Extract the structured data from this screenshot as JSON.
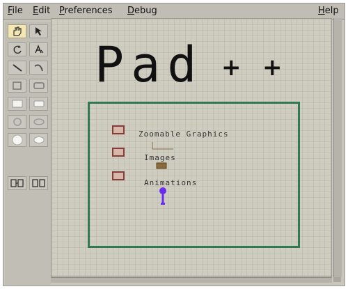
{
  "menubar": {
    "items": [
      "File",
      "Edit",
      "Preferences",
      "Debug"
    ],
    "help": "Help"
  },
  "toolbox": {
    "tools": [
      {
        "icon": "pan-hand-icon",
        "selected": true
      },
      {
        "icon": "select-arrow-icon"
      },
      {
        "icon": "rotate-hand-icon"
      },
      {
        "icon": "text-tool-icon"
      },
      {
        "icon": "line-tool-icon"
      },
      {
        "icon": "curve-tool-icon"
      },
      {
        "icon": "rectangle-outline-icon"
      },
      {
        "icon": "rounded-rectangle-outline-icon"
      },
      {
        "icon": "filled-rectangle-icon"
      },
      {
        "icon": "filled-rounded-rectangle-icon"
      },
      {
        "icon": "oval-outline-icon"
      },
      {
        "icon": "ellipse-outline-icon"
      },
      {
        "icon": "filled-oval-icon"
      },
      {
        "icon": "filled-ellipse-icon"
      },
      {
        "icon": "group-tool-icon"
      },
      {
        "icon": "ungroup-tool-icon"
      }
    ]
  },
  "canvas": {
    "title": "Pad",
    "plus": "+",
    "items": [
      {
        "label": "Zoomable Graphics"
      },
      {
        "label": "Images"
      },
      {
        "label": "Animations"
      }
    ]
  },
  "colors": {
    "frame": "#2f7a52",
    "bullet_border": "#8b3a3a",
    "pin": "#6a2cf0"
  }
}
